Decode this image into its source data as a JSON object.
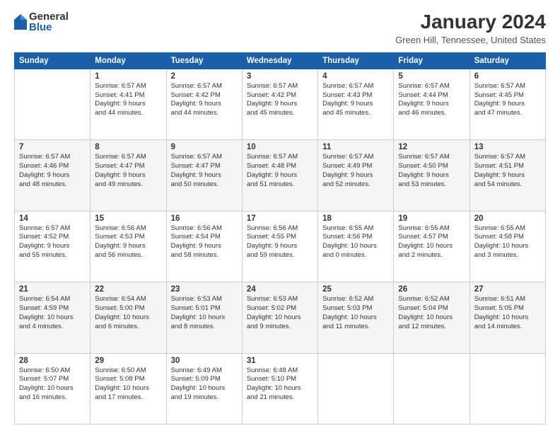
{
  "logo": {
    "general": "General",
    "blue": "Blue"
  },
  "header": {
    "title": "January 2024",
    "subtitle": "Green Hill, Tennessee, United States"
  },
  "days_of_week": [
    "Sunday",
    "Monday",
    "Tuesday",
    "Wednesday",
    "Thursday",
    "Friday",
    "Saturday"
  ],
  "weeks": [
    [
      {
        "day": "",
        "info": ""
      },
      {
        "day": "1",
        "info": "Sunrise: 6:57 AM\nSunset: 4:41 PM\nDaylight: 9 hours\nand 44 minutes."
      },
      {
        "day": "2",
        "info": "Sunrise: 6:57 AM\nSunset: 4:42 PM\nDaylight: 9 hours\nand 44 minutes."
      },
      {
        "day": "3",
        "info": "Sunrise: 6:57 AM\nSunset: 4:42 PM\nDaylight: 9 hours\nand 45 minutes."
      },
      {
        "day": "4",
        "info": "Sunrise: 6:57 AM\nSunset: 4:43 PM\nDaylight: 9 hours\nand 45 minutes."
      },
      {
        "day": "5",
        "info": "Sunrise: 6:57 AM\nSunset: 4:44 PM\nDaylight: 9 hours\nand 46 minutes."
      },
      {
        "day": "6",
        "info": "Sunrise: 6:57 AM\nSunset: 4:45 PM\nDaylight: 9 hours\nand 47 minutes."
      }
    ],
    [
      {
        "day": "7",
        "info": "Sunrise: 6:57 AM\nSunset: 4:46 PM\nDaylight: 9 hours\nand 48 minutes."
      },
      {
        "day": "8",
        "info": "Sunrise: 6:57 AM\nSunset: 4:47 PM\nDaylight: 9 hours\nand 49 minutes."
      },
      {
        "day": "9",
        "info": "Sunrise: 6:57 AM\nSunset: 4:47 PM\nDaylight: 9 hours\nand 50 minutes."
      },
      {
        "day": "10",
        "info": "Sunrise: 6:57 AM\nSunset: 4:48 PM\nDaylight: 9 hours\nand 51 minutes."
      },
      {
        "day": "11",
        "info": "Sunrise: 6:57 AM\nSunset: 4:49 PM\nDaylight: 9 hours\nand 52 minutes."
      },
      {
        "day": "12",
        "info": "Sunrise: 6:57 AM\nSunset: 4:50 PM\nDaylight: 9 hours\nand 53 minutes."
      },
      {
        "day": "13",
        "info": "Sunrise: 6:57 AM\nSunset: 4:51 PM\nDaylight: 9 hours\nand 54 minutes."
      }
    ],
    [
      {
        "day": "14",
        "info": "Sunrise: 6:57 AM\nSunset: 4:52 PM\nDaylight: 9 hours\nand 55 minutes."
      },
      {
        "day": "15",
        "info": "Sunrise: 6:56 AM\nSunset: 4:53 PM\nDaylight: 9 hours\nand 56 minutes."
      },
      {
        "day": "16",
        "info": "Sunrise: 6:56 AM\nSunset: 4:54 PM\nDaylight: 9 hours\nand 58 minutes."
      },
      {
        "day": "17",
        "info": "Sunrise: 6:56 AM\nSunset: 4:55 PM\nDaylight: 9 hours\nand 59 minutes."
      },
      {
        "day": "18",
        "info": "Sunrise: 6:55 AM\nSunset: 4:56 PM\nDaylight: 10 hours\nand 0 minutes."
      },
      {
        "day": "19",
        "info": "Sunrise: 6:55 AM\nSunset: 4:57 PM\nDaylight: 10 hours\nand 2 minutes."
      },
      {
        "day": "20",
        "info": "Sunrise: 6:55 AM\nSunset: 4:58 PM\nDaylight: 10 hours\nand 3 minutes."
      }
    ],
    [
      {
        "day": "21",
        "info": "Sunrise: 6:54 AM\nSunset: 4:59 PM\nDaylight: 10 hours\nand 4 minutes."
      },
      {
        "day": "22",
        "info": "Sunrise: 6:54 AM\nSunset: 5:00 PM\nDaylight: 10 hours\nand 6 minutes."
      },
      {
        "day": "23",
        "info": "Sunrise: 6:53 AM\nSunset: 5:01 PM\nDaylight: 10 hours\nand 8 minutes."
      },
      {
        "day": "24",
        "info": "Sunrise: 6:53 AM\nSunset: 5:02 PM\nDaylight: 10 hours\nand 9 minutes."
      },
      {
        "day": "25",
        "info": "Sunrise: 6:52 AM\nSunset: 5:03 PM\nDaylight: 10 hours\nand 11 minutes."
      },
      {
        "day": "26",
        "info": "Sunrise: 6:52 AM\nSunset: 5:04 PM\nDaylight: 10 hours\nand 12 minutes."
      },
      {
        "day": "27",
        "info": "Sunrise: 6:51 AM\nSunset: 5:05 PM\nDaylight: 10 hours\nand 14 minutes."
      }
    ],
    [
      {
        "day": "28",
        "info": "Sunrise: 6:50 AM\nSunset: 5:07 PM\nDaylight: 10 hours\nand 16 minutes."
      },
      {
        "day": "29",
        "info": "Sunrise: 6:50 AM\nSunset: 5:08 PM\nDaylight: 10 hours\nand 17 minutes."
      },
      {
        "day": "30",
        "info": "Sunrise: 6:49 AM\nSunset: 5:09 PM\nDaylight: 10 hours\nand 19 minutes."
      },
      {
        "day": "31",
        "info": "Sunrise: 6:48 AM\nSunset: 5:10 PM\nDaylight: 10 hours\nand 21 minutes."
      },
      {
        "day": "",
        "info": ""
      },
      {
        "day": "",
        "info": ""
      },
      {
        "day": "",
        "info": ""
      }
    ]
  ]
}
